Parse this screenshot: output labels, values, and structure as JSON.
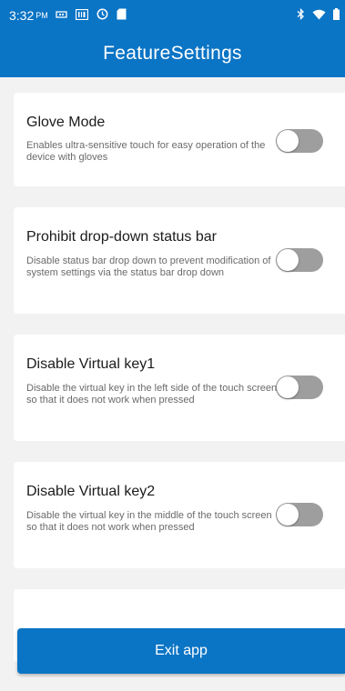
{
  "status_bar": {
    "time": "3:32",
    "ampm": "PM",
    "icons": [
      "usb-icon",
      "barcode-icon",
      "alarm-icon",
      "sd-card-icon",
      "bluetooth-icon",
      "wifi-icon",
      "battery-icon"
    ]
  },
  "app_bar": {
    "title": "FeatureSettings"
  },
  "settings": [
    {
      "title": "Glove Mode",
      "description": "Enables ultra-sensitive touch for easy operation of the device with gloves",
      "enabled": false
    },
    {
      "title": "Prohibit drop-down status bar",
      "description": "Disable status bar drop down to prevent modification of system settings via the status bar drop down",
      "enabled": false
    },
    {
      "title": "Disable Virtual key1",
      "description": "Disable the virtual key in the left side of the touch screen so that it does not work when pressed",
      "enabled": false
    },
    {
      "title": "Disable Virtual key2",
      "description": "Disable the virtual key in the middle of the touch screen so that it does not work when pressed",
      "enabled": false
    }
  ],
  "exit_button": {
    "label": "Exit app"
  },
  "colors": {
    "primary": "#0a74c5",
    "background": "#f2f2f2",
    "toggle_off": "#9e9e9e"
  }
}
